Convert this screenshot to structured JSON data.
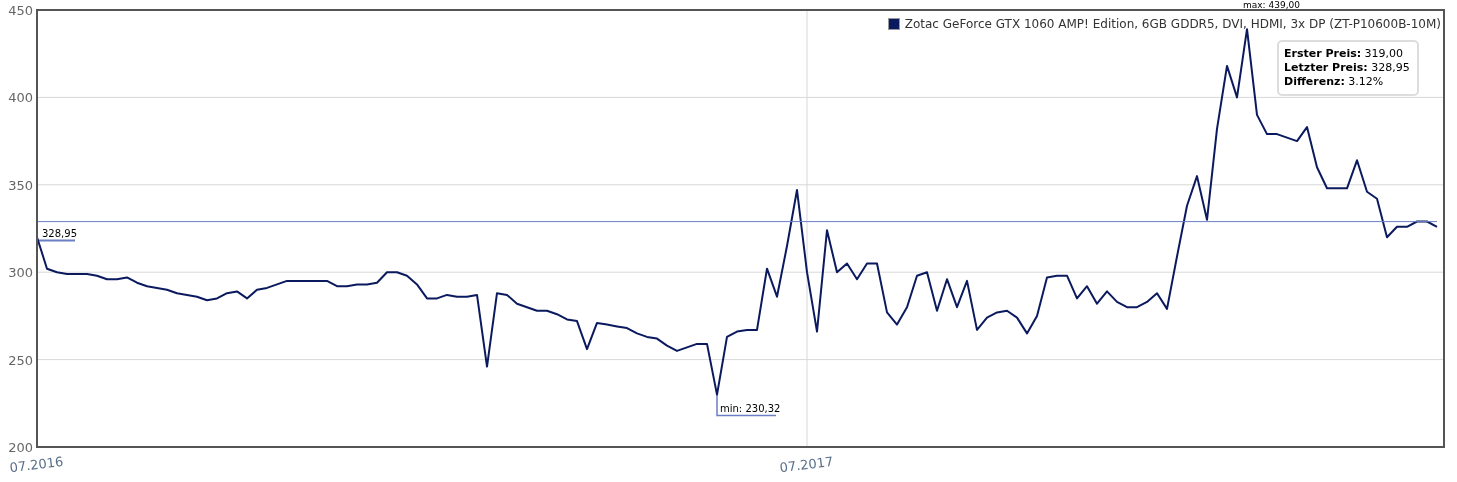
{
  "tooltip": {
    "lines": [
      "**Erster Preis:** 319,00",
      "**Letzter Preis:** 328,95",
      "**Differenz:** 3.12%"
    ]
  },
  "chart_data": {
    "type": "line",
    "grid": true,
    "ylim": [
      200,
      450
    ],
    "yticks": [
      200,
      250,
      300,
      350,
      400,
      450
    ],
    "categories": [
      "07.2016",
      null,
      null,
      null,
      null,
      null,
      null,
      null,
      null,
      null,
      null,
      null,
      null,
      null,
      null,
      null,
      null,
      null,
      null,
      null,
      null,
      null,
      null,
      null,
      null,
      null,
      null,
      null,
      null,
      null,
      null,
      null,
      null,
      null,
      null,
      null,
      null,
      null,
      null,
      null,
      null,
      null,
      null,
      null,
      null,
      null,
      null,
      null,
      null,
      null,
      null,
      null,
      null,
      null,
      null,
      null,
      null,
      null,
      null,
      null,
      null,
      null,
      null,
      null,
      null,
      null,
      null,
      null,
      null,
      null,
      null,
      null,
      null,
      null,
      null,
      null,
      null,
      "07.2017",
      null,
      null,
      null,
      null,
      null,
      null,
      null,
      null,
      null,
      null,
      null,
      null,
      null,
      null,
      null,
      null,
      null,
      null,
      null,
      null,
      null,
      null,
      null,
      null,
      null,
      null,
      null,
      null,
      null,
      null,
      null,
      null,
      null,
      null,
      null,
      null,
      null,
      null,
      null,
      null,
      null,
      null,
      null,
      null,
      null,
      null,
      null,
      null,
      null,
      null,
      null,
      null,
      null,
      null,
      null,
      null,
      null,
      null,
      null,
      null,
      null,
      null,
      null
    ],
    "series": [
      {
        "name": "Zotac GeForce GTX 1060 AMP! Edition, 6GB GDDR5, DVI, HDMI, 3x DP (ZT-P10600B-10M)",
        "color": "#0b1a5e",
        "values": [
          320,
          302,
          300,
          299,
          299,
          299,
          298,
          296,
          296,
          297,
          294,
          292,
          291,
          290,
          288,
          287,
          286,
          284,
          285,
          288,
          289,
          285,
          290,
          291,
          293,
          295,
          295,
          295,
          295,
          295,
          292,
          292,
          293,
          293,
          294,
          300,
          300,
          298,
          293,
          285,
          285,
          287,
          286,
          286,
          287,
          246,
          288,
          287,
          282,
          280,
          278,
          278,
          276,
          273,
          272,
          256,
          271,
          270,
          269,
          268,
          265,
          263,
          262,
          258,
          255,
          257,
          259,
          259,
          230,
          263,
          266,
          267,
          267,
          302,
          286,
          315,
          347,
          300,
          266,
          324,
          300,
          305,
          296,
          305,
          305,
          277,
          270,
          280,
          298,
          300,
          278,
          296,
          280,
          295,
          267,
          274,
          277,
          278,
          274,
          265,
          275,
          297,
          298,
          298,
          285,
          292,
          282,
          289,
          283,
          280,
          280,
          283,
          288,
          279,
          309,
          338,
          355,
          330,
          382,
          418,
          400,
          439,
          390,
          379,
          379,
          377,
          375,
          383,
          360,
          348,
          348,
          348,
          364,
          346,
          342,
          320,
          326,
          326,
          329,
          329,
          326
        ]
      },
      {
        "name": "328,95",
        "color": "#6b7fc4",
        "values": [
          328.95,
          328.95,
          328.95,
          328.95,
          328.95,
          328.95,
          328.95,
          328.95,
          328.95,
          328.95,
          328.95,
          328.95,
          328.95,
          328.95,
          328.95,
          328.95,
          328.95,
          328.95,
          328.95,
          328.95,
          328.95,
          328.95,
          328.95,
          328.95,
          328.95,
          328.95,
          328.95,
          328.95,
          328.95,
          328.95,
          328.95,
          328.95,
          328.95,
          328.95,
          328.95,
          328.95,
          328.95,
          328.95,
          328.95,
          328.95,
          328.95,
          328.95,
          328.95,
          328.95,
          328.95,
          328.95,
          328.95,
          328.95,
          328.95,
          328.95,
          328.95,
          328.95,
          328.95,
          328.95,
          328.95,
          328.95,
          328.95,
          328.95,
          328.95,
          328.95,
          328.95,
          328.95,
          328.95,
          328.95,
          328.95,
          328.95,
          328.95,
          328.95,
          328.95,
          328.95,
          328.95,
          328.95,
          328.95,
          328.95,
          328.95,
          328.95,
          328.95,
          328.95,
          328.95,
          328.95,
          328.95,
          328.95,
          328.95,
          328.95,
          328.95,
          328.95,
          328.95,
          328.95,
          328.95,
          328.95,
          328.95,
          328.95,
          328.95,
          328.95,
          328.95,
          328.95,
          328.95,
          328.95,
          328.95,
          328.95,
          328.95,
          328.95,
          328.95,
          328.95,
          328.95,
          328.95,
          328.95,
          328.95,
          328.95,
          328.95,
          328.95,
          328.95,
          328.95,
          328.95,
          328.95,
          328.95,
          328.95,
          328.95,
          328.95,
          328.95,
          328.95,
          328.95,
          328.95,
          328.95,
          328.95,
          328.95,
          328.95,
          328.95,
          328.95,
          328.95,
          328.95,
          328.95,
          328.95,
          328.95,
          328.95,
          328.95,
          328.95,
          328.95,
          328.95,
          328.95,
          328.95
        ]
      }
    ],
    "annotations": [
      "min: 230,32",
      "max: 439,00"
    ]
  }
}
